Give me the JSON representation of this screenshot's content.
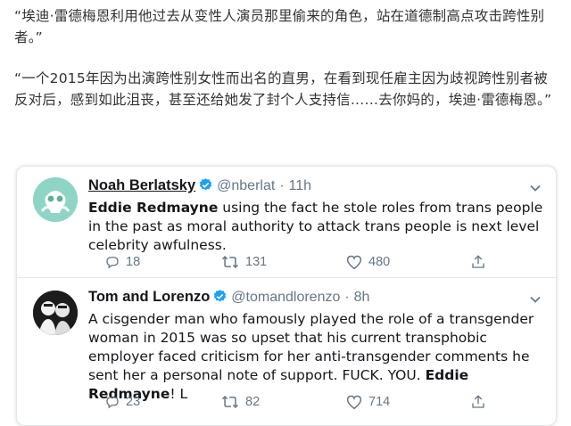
{
  "article": {
    "paragraph1": "“埃迪·雷德梅恩利用他过去从变性人演员那里偷来的角色，站在道德制高点攻击跨性别者。”",
    "paragraph2": "“一个2015年因为出演跨性别女性而出名的直男，在看到现任雇主因为歧视跨性别者被反对后，感到如此沮丧，甚至还给她发了封个人支持信……去你妈的，埃迪·雷德梅恩。”"
  },
  "tweets": [
    {
      "name": "Noah Berlatsky",
      "handle": "@nberlat",
      "separator": "·",
      "time": "11h",
      "text_bold": "Eddie Redmayne",
      "text_rest": " using the fact he stole roles from trans people in the past as moral authority to attack trans people is next level celebrity awfulness.",
      "replies": "18",
      "retweets": "131",
      "likes": "480"
    },
    {
      "name": "Tom and Lorenzo",
      "handle": "@tomandlorenzo",
      "separator": "·",
      "time": "8h",
      "text_start": "A cisgender man who famously played the role of a transgender woman in 2015 was so upset that his current transphobic employer faced criticism for her anti-transgender comments he sent her a personal note of support. FUCK. YOU. ",
      "text_bold": "Eddie Redmayne",
      "text_end": "! L",
      "replies": "23",
      "retweets": "82",
      "likes": "714"
    }
  ],
  "colors": {
    "verified": "#1da1f2",
    "muted": "#657786",
    "text": "#14171a"
  },
  "icons": [
    "verified-badge-icon",
    "chevron-down-icon",
    "reply-icon",
    "retweet-icon",
    "like-icon",
    "share-icon"
  ]
}
